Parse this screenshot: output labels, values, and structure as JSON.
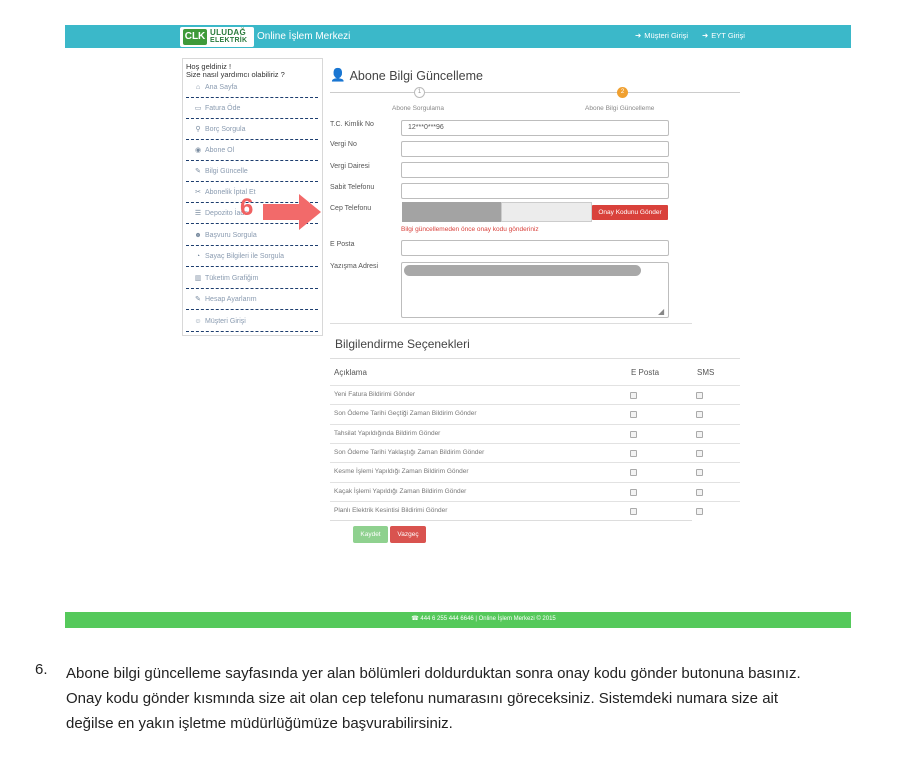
{
  "header": {
    "logo_mark": "CLK",
    "logo_line1": "ULUDAĞ",
    "logo_line2": "ELEKTRİK",
    "title": "Online İşlem Merkezi",
    "links": [
      "Müşteri Girişi",
      "EYT Girişi"
    ]
  },
  "sidebar": {
    "welcome1": "Hoş geldiniz !",
    "welcome2": "Size nasıl yardımcı olabiliriz ?",
    "items": [
      {
        "label": "Ana Sayfa",
        "icon": "home-icon"
      },
      {
        "label": "Fatura Öde",
        "icon": "credit-card-icon"
      },
      {
        "label": "Borç Sorgula",
        "icon": "search-icon"
      },
      {
        "label": "Abone Ol",
        "icon": "globe-icon"
      },
      {
        "label": "Bilgi Güncelle",
        "icon": "edit-icon"
      },
      {
        "label": "Abonelik İptal Et",
        "icon": "scissors-icon"
      },
      {
        "label": "Depozito İade",
        "icon": "list-icon"
      },
      {
        "label": "Başvuru Sorgula",
        "icon": "user-plus-icon"
      },
      {
        "label": "Sayaç Bilgileri ile Sorgula",
        "icon": "gauge-icon"
      },
      {
        "label": "Tüketim Grafiğim",
        "icon": "chart-icon"
      },
      {
        "label": "Hesap Ayarlarım",
        "icon": "edit-icon"
      },
      {
        "label": "Müşteri Girişi",
        "icon": "users-icon"
      }
    ]
  },
  "page": {
    "title": "Abone Bilgi Güncelleme",
    "steps": [
      {
        "number": "1",
        "label": "Abone Sorgulama"
      },
      {
        "number": "2",
        "label": "Abone Bilgi Güncelleme"
      }
    ]
  },
  "form": {
    "tc_label": "T.C. Kimlik No",
    "tc_value": "12***0***96",
    "vergi_no_label": "Vergi No",
    "vergi_dairesi_label": "Vergi Dairesi",
    "sabit_tel_label": "Sabit Telefonu",
    "cep_label": "Cep Telefonu",
    "otp_button": "Onay Kodunu Gönder",
    "otp_warning": "Bilgi güncellemeden önce onay kodu gönderiniz",
    "email_label": "E Posta",
    "address_label": "Yazışma Adresi"
  },
  "annotation": {
    "step_number": "6"
  },
  "notifications": {
    "title": "Bilgilendirme Seçenekleri",
    "headers": [
      "Açıklama",
      "E Posta",
      "SMS"
    ],
    "rows": [
      "Yeni Fatura Bildirimi Gönder",
      "Son Ödeme Tarihi Geçtiği Zaman Bildirim Gönder",
      "Tahsilat Yapıldığında Bildirim Gönder",
      "Son Ödeme Tarihi Yaklaştığı Zaman Bildirim Gönder",
      "Kesme İşlemi Yapıldığı Zaman Bildirim Gönder",
      "Kaçak İşlemi Yapıldığı Zaman Bildirim Gönder",
      "Planlı Elektrik Kesintisi Bildirimi Gönder"
    ]
  },
  "actions": {
    "save": "Kaydet",
    "cancel": "Vazgeç"
  },
  "footer": {
    "text": "☎ 444 6 255  444 6646 | Online İşlem Merkezi © 2015"
  },
  "instruction": {
    "number": "6.",
    "text": "Abone bilgi güncelleme sayfasında yer alan bölümleri doldurduktan sonra onay kodu gönder butonuna basınız. Onay kodu gönder kısmında size ait olan cep telefonu numarasını göreceksiniz. Sistemdeki numara size ait değilse en yakın işletme müdürlüğümüze başvurabilirsiniz."
  }
}
